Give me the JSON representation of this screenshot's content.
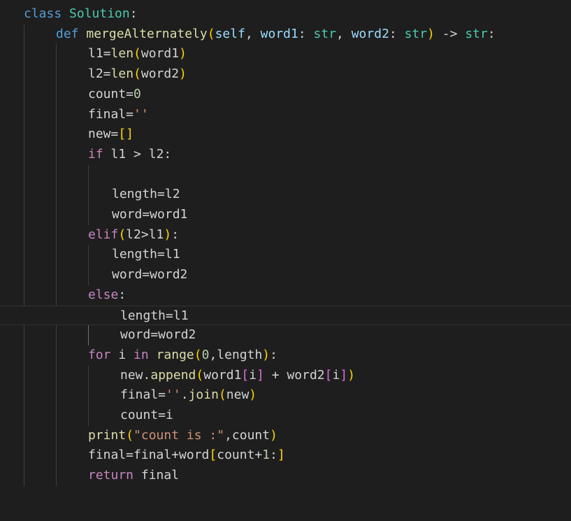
{
  "editor": {
    "language": "python",
    "colors": {
      "background": "#1e1e1e",
      "keyword": "#569cd6",
      "control": "#c586c0",
      "class_name": "#4ec9b0",
      "function": "#dcdcaa",
      "parameter": "#9cdcfe",
      "number": "#b5cea8",
      "string": "#ce9178",
      "bracket_1": "#ffd700",
      "bracket_2": "#da70d6"
    },
    "lines": [
      {
        "indent": 0,
        "tokens": [
          [
            "kw",
            "class"
          ],
          [
            "id",
            " "
          ],
          [
            "cls",
            "Solution"
          ],
          [
            "id",
            ":"
          ]
        ]
      },
      {
        "indent": 1,
        "tokens": [
          [
            "kw",
            "def"
          ],
          [
            "id",
            " "
          ],
          [
            "fn",
            "mergeAlternately"
          ],
          [
            "p1",
            "("
          ],
          [
            "var",
            "self"
          ],
          [
            "id",
            ", "
          ],
          [
            "var",
            "word1"
          ],
          [
            "id",
            ": "
          ],
          [
            "cls",
            "str"
          ],
          [
            "id",
            ", "
          ],
          [
            "var",
            "word2"
          ],
          [
            "id",
            ": "
          ],
          [
            "cls",
            "str"
          ],
          [
            "p1",
            ")"
          ],
          [
            "id",
            " -> "
          ],
          [
            "cls",
            "str"
          ],
          [
            "id",
            ":"
          ]
        ]
      },
      {
        "indent": 2,
        "tokens": [
          [
            "hl",
            "l1"
          ],
          [
            "id",
            "="
          ],
          [
            "fn",
            "len"
          ],
          [
            "p1",
            "("
          ],
          [
            "id",
            "word1"
          ],
          [
            "p1",
            ")"
          ]
        ]
      },
      {
        "indent": 2,
        "tokens": [
          [
            "id",
            "l2="
          ],
          [
            "fn",
            "len"
          ],
          [
            "p1",
            "("
          ],
          [
            "id",
            "word2"
          ],
          [
            "p1",
            ")"
          ]
        ]
      },
      {
        "indent": 2,
        "tokens": [
          [
            "id",
            "count="
          ],
          [
            "num",
            "0"
          ]
        ]
      },
      {
        "indent": 2,
        "tokens": [
          [
            "id",
            "final="
          ],
          [
            "str",
            "''"
          ]
        ]
      },
      {
        "indent": 2,
        "tokens": [
          [
            "id",
            "new="
          ],
          [
            "p1",
            "[]"
          ]
        ]
      },
      {
        "indent": 2,
        "tokens": [
          [
            "ctl",
            "if"
          ],
          [
            "id",
            " "
          ],
          [
            "hl",
            "l1"
          ],
          [
            "id",
            " > l2:"
          ]
        ]
      },
      {
        "indent": 2,
        "tokens": []
      },
      {
        "indent": 3,
        "tokens": [
          [
            "id",
            "length=l2"
          ]
        ]
      },
      {
        "indent": 3,
        "tokens": [
          [
            "id",
            "word=word1"
          ]
        ]
      },
      {
        "indent": 2,
        "tokens": [
          [
            "ctl",
            "elif"
          ],
          [
            "p1",
            "("
          ],
          [
            "id",
            "l2>"
          ],
          [
            "hl",
            "l1"
          ],
          [
            "p1",
            ")"
          ],
          [
            "id",
            ":"
          ]
        ]
      },
      {
        "indent": 3,
        "tokens": [
          [
            "id",
            "length="
          ],
          [
            "hl",
            "l1"
          ]
        ]
      },
      {
        "indent": 3,
        "tokens": [
          [
            "id",
            "word=word2"
          ]
        ]
      },
      {
        "indent": 2,
        "tokens": [
          [
            "ctl",
            "else"
          ],
          [
            "id",
            ":"
          ]
        ]
      },
      {
        "indent": 3.35,
        "tokens": [
          [
            "id",
            "length="
          ],
          [
            "hl",
            "l1"
          ]
        ],
        "current": true
      },
      {
        "indent": 3.35,
        "tokens": [
          [
            "id",
            "word=word2"
          ]
        ]
      },
      {
        "indent": 2,
        "tokens": [
          [
            "ctl",
            "for"
          ],
          [
            "id",
            " i "
          ],
          [
            "ctl",
            "in"
          ],
          [
            "id",
            " "
          ],
          [
            "fn",
            "range"
          ],
          [
            "p1",
            "("
          ],
          [
            "num",
            "0"
          ],
          [
            "id",
            ",length"
          ],
          [
            "p1",
            ")"
          ],
          [
            "id",
            ":"
          ]
        ]
      },
      {
        "indent": 3.35,
        "tokens": [
          [
            "id",
            "new."
          ],
          [
            "fn",
            "append"
          ],
          [
            "p1",
            "("
          ],
          [
            "id",
            "word1"
          ],
          [
            "p2",
            "["
          ],
          [
            "id",
            "i"
          ],
          [
            "p2",
            "]"
          ],
          [
            "id",
            " + word2"
          ],
          [
            "p2",
            "["
          ],
          [
            "id",
            "i"
          ],
          [
            "p2",
            "]"
          ],
          [
            "p1",
            ")"
          ]
        ]
      },
      {
        "indent": 3.35,
        "tokens": [
          [
            "id",
            "final="
          ],
          [
            "str",
            "''"
          ],
          [
            "id",
            "."
          ],
          [
            "fn",
            "join"
          ],
          [
            "p1",
            "("
          ],
          [
            "id",
            "new"
          ],
          [
            "p1",
            ")"
          ]
        ]
      },
      {
        "indent": 3.35,
        "tokens": [
          [
            "id",
            "count=i"
          ]
        ]
      },
      {
        "indent": 2,
        "tokens": [
          [
            "fn",
            "print"
          ],
          [
            "p1",
            "("
          ],
          [
            "str",
            "\"count is :\""
          ],
          [
            "id",
            ",count"
          ],
          [
            "p1",
            ")"
          ]
        ]
      },
      {
        "indent": 2,
        "tokens": [
          [
            "id",
            "final=final+word"
          ],
          [
            "p1",
            "["
          ],
          [
            "id",
            "count+"
          ],
          [
            "num",
            "1"
          ],
          [
            "id",
            ":"
          ],
          [
            "p1",
            "]"
          ]
        ]
      },
      {
        "indent": 2,
        "tokens": [
          [
            "ctl",
            "return"
          ],
          [
            "id",
            " final"
          ]
        ]
      }
    ]
  }
}
